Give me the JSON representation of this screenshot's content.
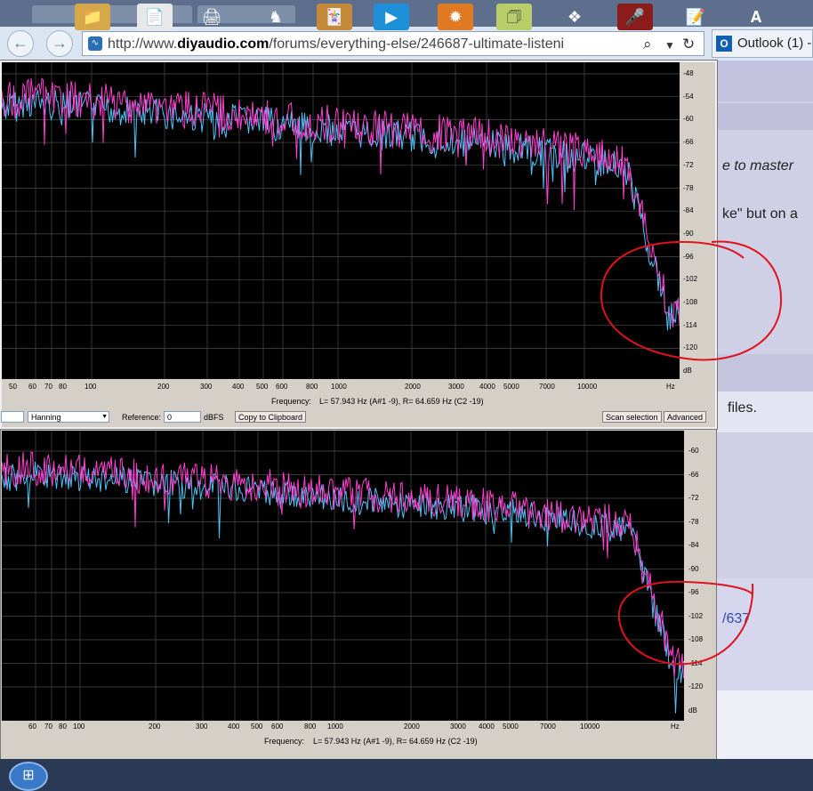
{
  "browser": {
    "url_prefix": "http://www.",
    "url_domain": "diyaudio.com",
    "url_path": "/forums/everything-else/246687-ultimate-listeni",
    "outlook_tab_label": "Outlook (1) -",
    "back_icon": "back-arrow-icon",
    "forward_icon": "forward-arrow-icon"
  },
  "page": {
    "snippet_1": "e to master",
    "snippet_2": "ke\" but on a",
    "snippet_3": "files.",
    "snippet_4": "/637"
  },
  "analyzer_top": {
    "y_ticks": [
      "-48",
      "-54",
      "-60",
      "-66",
      "-72",
      "-78",
      "-84",
      "-90",
      "-96",
      "-102",
      "-108",
      "-114",
      "-120",
      "dB"
    ],
    "x_ticks": [
      "50",
      "60",
      "70",
      "80",
      "100",
      "200",
      "300",
      "400",
      "500",
      "600",
      "800",
      "1000",
      "2000",
      "3000",
      "4000",
      "5000",
      "7000",
      "10000",
      "Hz"
    ],
    "frequency_label": "Frequency:",
    "frequency_value": "L= 57.943 Hz (A#1 -9), R= 64.659 Hz (C2 -19)",
    "window_func": "Hanning",
    "reference_label": "Reference:",
    "reference_value": "0",
    "reference_unit": "dBFS",
    "copy_button": "Copy to Clipboard",
    "scan_button": "Scan selection",
    "advanced_button": "Advanced"
  },
  "analyzer_bottom": {
    "y_ticks": [
      "-60",
      "-66",
      "-72",
      "-78",
      "-84",
      "-90",
      "-96",
      "-102",
      "-108",
      "-114",
      "-120",
      "dB"
    ],
    "x_ticks": [
      "60",
      "70",
      "80",
      "100",
      "200",
      "300",
      "400",
      "500",
      "600",
      "800",
      "1000",
      "2000",
      "3000",
      "4000",
      "5000",
      "7000",
      "10000",
      "Hz"
    ],
    "frequency_label": "Frequency:",
    "frequency_value": "L= 57.943 Hz (A#1 -9), R= 64.659 Hz (C2 -19)"
  },
  "colors": {
    "trace_left": "#ff3fd0",
    "trace_right": "#4fc3f7",
    "annotation": "#e0121b",
    "plot_bg": "#000000",
    "grid": "#4a4a4a"
  },
  "taskbar": {
    "icons": [
      "windows-start-icon",
      "file-explorer-icon",
      "document-icon",
      "scanner-icon",
      "chess-icon",
      "game-icon",
      "media-player-icon",
      "photo-gallery-icon",
      "notes-icon",
      "games-folder-icon",
      "audio-app-icon",
      "notepad-icon",
      "text-editor-icon"
    ]
  }
}
